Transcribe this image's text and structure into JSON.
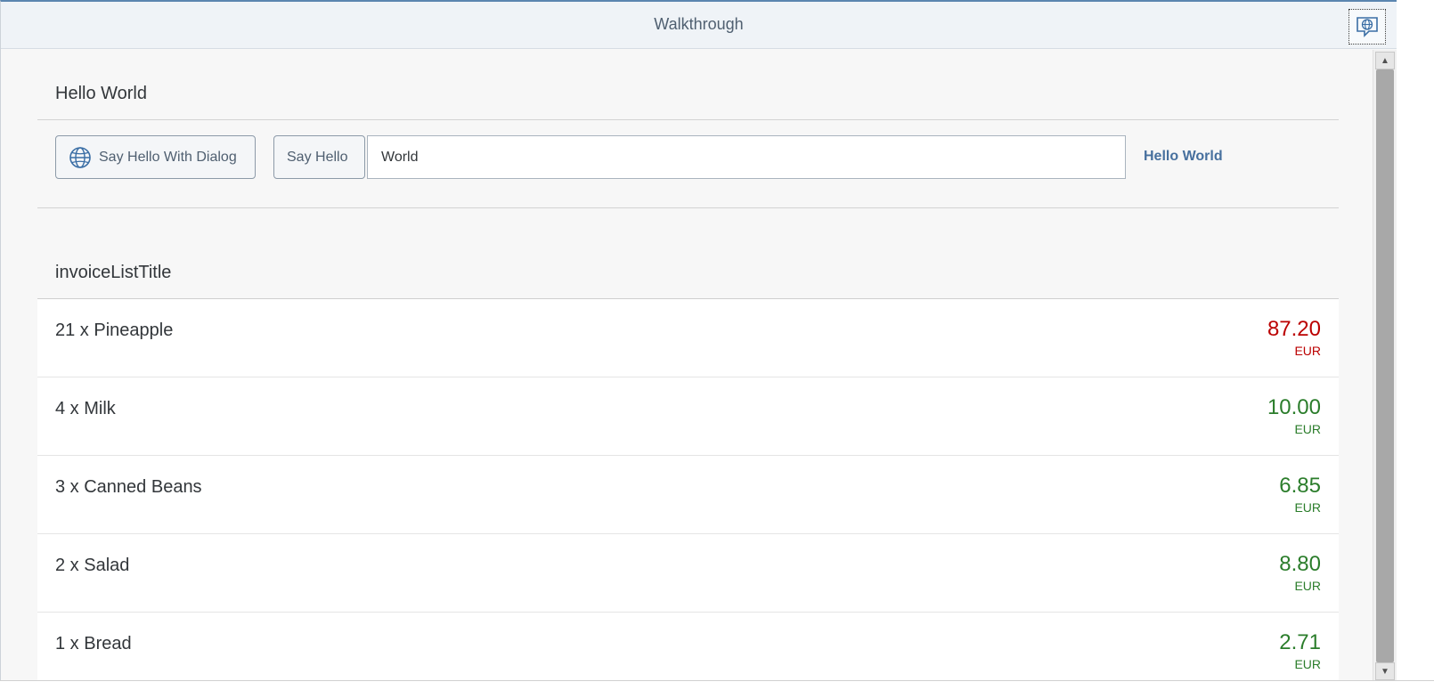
{
  "shell": {
    "title": "Walkthrough",
    "icon": "globe-chat-icon"
  },
  "panel": {
    "title": "Hello World",
    "dialog_button": {
      "label": "Say Hello With Dialog",
      "icon": "globe-icon"
    },
    "hello_button": {
      "label": "Say Hello"
    },
    "name_input": {
      "value": "World"
    },
    "greeting_text": "Hello World"
  },
  "invoices": {
    "title": "invoiceListTitle",
    "items": [
      {
        "name": "21 x Pineapple",
        "price": "87.20",
        "currency": "EUR",
        "state": "negative"
      },
      {
        "name": "4 x Milk",
        "price": "10.00",
        "currency": "EUR",
        "state": "positive"
      },
      {
        "name": "3 x Canned Beans",
        "price": "6.85",
        "currency": "EUR",
        "state": "positive"
      },
      {
        "name": "2 x Salad",
        "price": "8.80",
        "currency": "EUR",
        "state": "positive"
      },
      {
        "name": "1 x Bread",
        "price": "2.71",
        "currency": "EUR",
        "state": "positive"
      }
    ]
  },
  "colors": {
    "negative": "#bb0000",
    "positive": "#2b7d2b",
    "link": "#47709e"
  }
}
